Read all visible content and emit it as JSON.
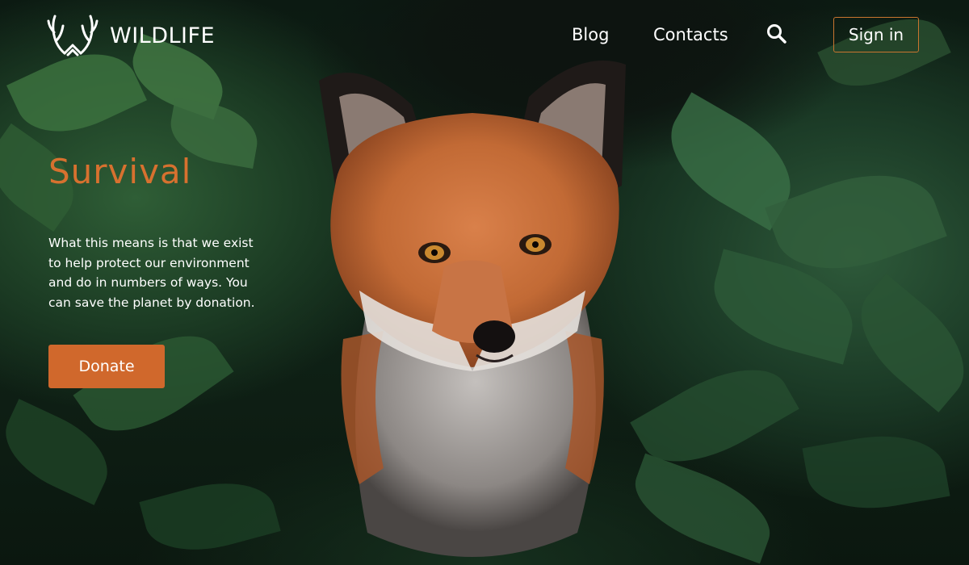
{
  "brand": {
    "name": "WILDLIFE",
    "logo_icon": "antlers-icon"
  },
  "nav": {
    "links": [
      {
        "label": "Blog"
      },
      {
        "label": "Contacts"
      }
    ],
    "search_icon": "search-icon",
    "signin_label": "Sign in"
  },
  "hero": {
    "title": "Survival",
    "body": "What this means is that we exist to help protect our environment and do in numbers of ways. You can save the planet by donation.",
    "donate_label": "Donate",
    "image_subject": "red fox in green foliage"
  },
  "colors": {
    "accent": "#d0682c",
    "title": "#d7712f",
    "text": "#ffffff",
    "signin_border": "#c9752f"
  }
}
